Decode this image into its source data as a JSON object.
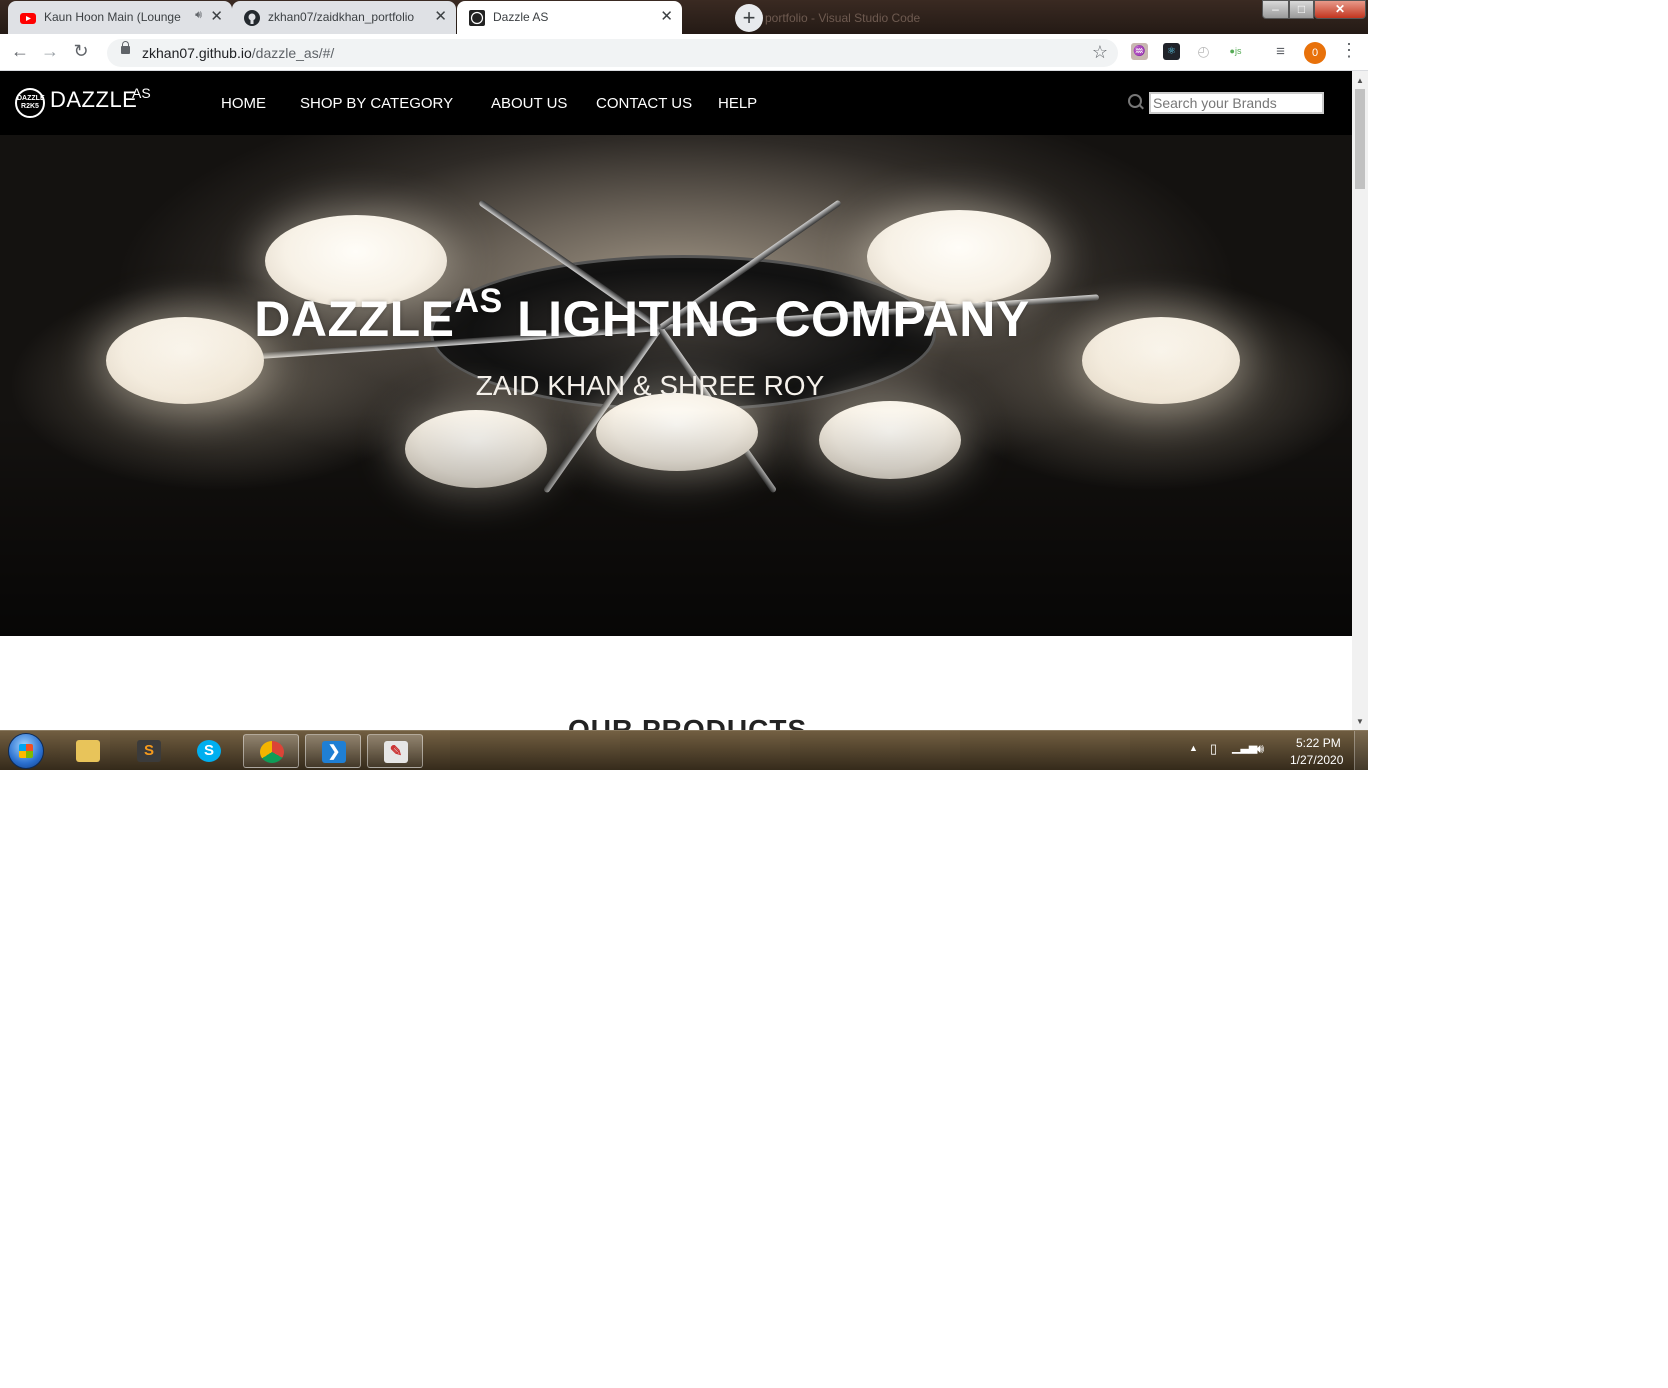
{
  "browser": {
    "tabs": [
      {
        "title": "Kaun Hoon Main (Lounge Mix)",
        "favicon": "youtube-icon",
        "muted_icon": "speaker-icon"
      },
      {
        "title": "zkhan07/zaidkhan_portfolio",
        "favicon": "github-icon"
      },
      {
        "title": "Dazzle AS",
        "favicon": "dazzle-logo-icon",
        "active": true
      }
    ],
    "new_tab_label": "+",
    "background_window_title": "portfolio - Visual Studio Code",
    "url_host": "zkhan07.github.io",
    "url_path": "/dazzle_as/#/",
    "profile_initial": "0",
    "window_controls": {
      "minimize": "–",
      "maximize": "□",
      "close": "✕"
    }
  },
  "site": {
    "logo_badge": "DAZZLE R2K5",
    "logo_text": "DAZZLE",
    "logo_sup": "AS",
    "nav": [
      "HOME",
      "SHOP BY CATEGORY",
      "ABOUT US",
      "CONTACT US",
      "HELP"
    ],
    "search_placeholder": "Search your Brands",
    "hero": {
      "title_main": "DAZZLE",
      "title_sup": "AS",
      "title_rest": " LIGHTING COMPANY",
      "subtitle": "ZAID KHAN & SHREE ROY"
    },
    "products_heading": "OUR PRODUCTS"
  },
  "taskbar": {
    "apps": [
      "explorer-icon",
      "sublime-text-icon",
      "skype-icon",
      "chrome-icon",
      "vscode-icon",
      "paint-icon"
    ],
    "time": "5:22 PM",
    "date": "1/27/2020"
  },
  "colors": {
    "site_nav_bg": "#000000",
    "accent_orange": "#e8710a",
    "hero_text": "#ffffff"
  }
}
